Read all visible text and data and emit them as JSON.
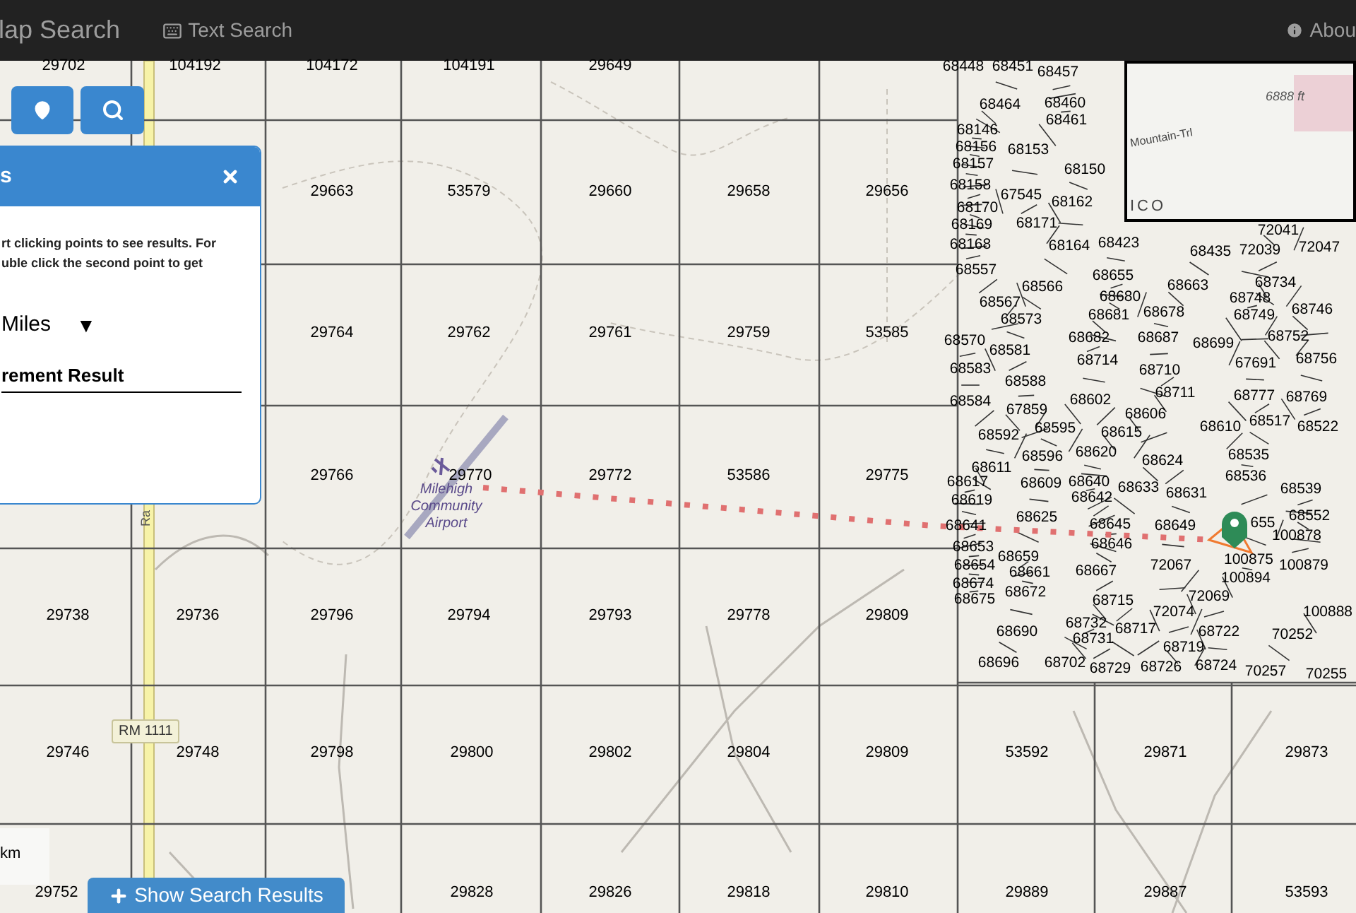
{
  "header": {
    "title": "lap Search",
    "links": [
      {
        "label": "Text Search",
        "kind": "keyboard"
      }
    ],
    "about": "Abou"
  },
  "map": {
    "grid_parcels": [
      "29702",
      "104192",
      "104172",
      "104191",
      "29649",
      "29663",
      "53579",
      "29660",
      "29658",
      "29656",
      "29764",
      "29762",
      "29761",
      "29759",
      "53585",
      "29766",
      "29770",
      "29772",
      "53586",
      "29775",
      "29738",
      "29736",
      "29796",
      "29794",
      "29793",
      "29778",
      "29809",
      "29746",
      "29748",
      "29798",
      "29800",
      "29802",
      "29804",
      "29809",
      "53592",
      "29871",
      "29873",
      "29752",
      "29828",
      "29826",
      "29818",
      "29810",
      "29889",
      "29887",
      "53593"
    ],
    "subdivision_parcels": [
      "68448",
      "68451",
      "68457",
      "68464",
      "68460",
      "68146",
      "68461",
      "68156",
      "68153",
      "68157",
      "68150",
      "68158",
      "67545",
      "68170",
      "68162",
      "68169",
      "68171",
      "72041",
      "68168",
      "68164",
      "68423",
      "68435",
      "72039",
      "72047",
      "68557",
      "68655",
      "68566",
      "68663",
      "68734",
      "68567",
      "68680",
      "68748",
      "68573",
      "68681",
      "68678",
      "68749",
      "68746",
      "68570",
      "68682",
      "68687",
      "68699",
      "68752",
      "68581",
      "68714",
      "68756",
      "68583",
      "68710",
      "67691",
      "68588",
      "68584",
      "68602",
      "68711",
      "68777",
      "68769",
      "67859",
      "68606",
      "68595",
      "68610",
      "68517",
      "68522",
      "68592",
      "68615",
      "68596",
      "68620",
      "68624",
      "68535",
      "68611",
      "68617",
      "68609",
      "68640",
      "68633",
      "68536",
      "68539",
      "68619",
      "68642",
      "68631",
      "68641",
      "68625",
      "68645",
      "68649",
      "655",
      "68552",
      "68646",
      "100878",
      "68653",
      "68659",
      "68654",
      "72067",
      "100875",
      "100879",
      "68661",
      "68667",
      "100894",
      "68674",
      "68672",
      "68675",
      "68715",
      "72069",
      "72074",
      "100888",
      "68690",
      "68732",
      "68717",
      "68722",
      "68731",
      "70252",
      "68719",
      "68696",
      "68702",
      "68729",
      "68726",
      "68724",
      "70257",
      "70255"
    ],
    "place_labels": [
      {
        "kind": "airport",
        "text": "Milehigh Community Airport"
      },
      {
        "kind": "road",
        "text": "Ra"
      }
    ],
    "road_shield": "RM 1111",
    "inset": {
      "elevation": "6888 ft",
      "trail": "Mountain-Trl",
      "region": "ICO"
    },
    "scale": "km"
  },
  "panel": {
    "title": "s",
    "instructions": [
      "rt clicking points to see results. For",
      "uble click the second point to get"
    ],
    "unit": "Miles",
    "dropdown_arrow": "▼",
    "result_heading": "rement Result"
  },
  "show_results_button": "Show Search Results"
}
